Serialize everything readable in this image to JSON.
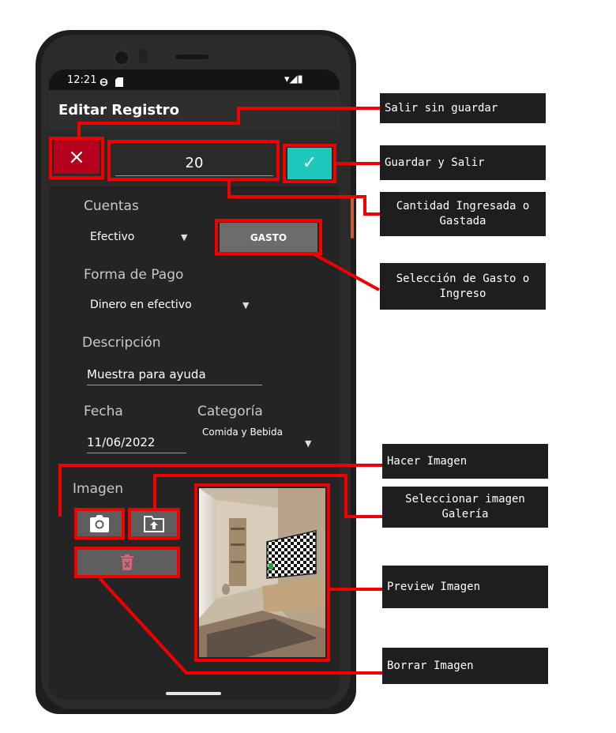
{
  "status_bar": {
    "time": "12:21",
    "icons": "▾◢▮"
  },
  "app_bar": {
    "title": "Editar Registro"
  },
  "amount": {
    "value": "20"
  },
  "buttons": {
    "cancel_icon": "×",
    "confirm_icon": "✓",
    "gasto_label": "GASTO"
  },
  "form": {
    "cuentas_label": "Cuentas",
    "cuentas_value": "Efectivo",
    "forma_pago_label": "Forma de Pago",
    "forma_pago_value": "Dinero en efectivo",
    "descripcion_label": "Descripción",
    "descripcion_value": "Muestra para ayuda",
    "fecha_label": "Fecha",
    "fecha_value": "11/06/2022",
    "categoria_label": "Categoría",
    "categoria_value": "Comida y Bebida",
    "imagen_label": "Imagen"
  },
  "icons": {
    "camera": "camera-icon",
    "gallery": "gallery-upload-icon",
    "delete": "trash-icon",
    "dropdown": "caret-down-icon"
  },
  "callouts": {
    "salir": "Salir sin guardar",
    "guardar": "Guardar y Salir",
    "cantidad": "Cantidad Ingresada o Gastada",
    "seleccion": "Selección de Gasto o Ingreso",
    "hacer_imagen": "Hacer Imagen",
    "seleccionar_imagen": "Seleccionar imagen Galería",
    "preview": "Preview Imagen",
    "borrar": "Borrar Imagen"
  },
  "colors": {
    "highlight": "#f20000",
    "cancel": "#b5001e",
    "confirm": "#1fc8bb",
    "callout_bg": "#1e1e1e"
  }
}
